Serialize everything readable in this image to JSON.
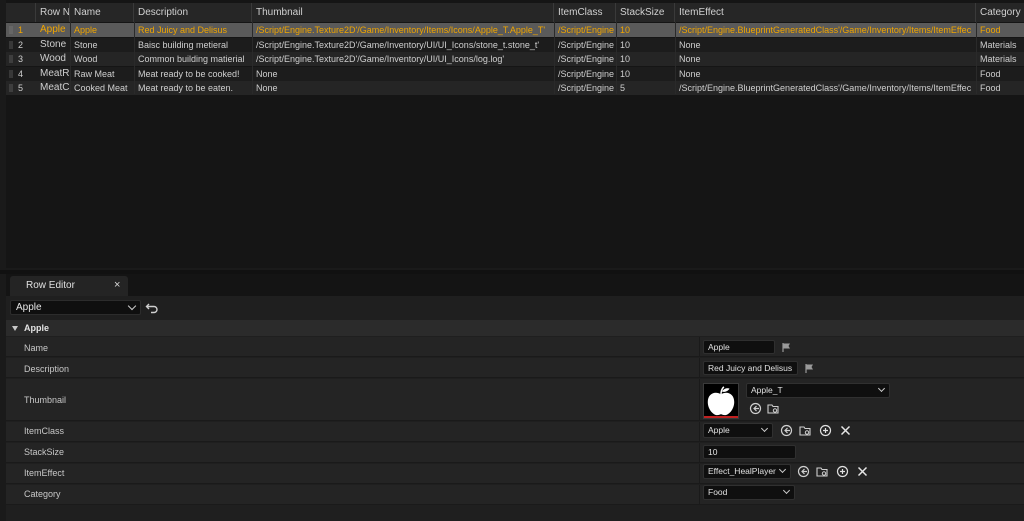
{
  "table": {
    "headers": [
      "",
      "Row Na",
      "Name",
      "Description",
      "Thumbnail",
      "ItemClass",
      "StackSize",
      "ItemEffect",
      "Category"
    ],
    "rows": [
      [
        "1",
        "Apple",
        "Apple",
        "Red Juicy and Delisus",
        "/Script/Engine.Texture2D'/Game/Inventory/Items/Icons/Apple_T.Apple_T'",
        "/Script/Engine",
        "10",
        "/Script/Engine.BlueprintGeneratedClass'/Game/Inventory/Items/ItemEffec",
        "Food"
      ],
      [
        "2",
        "Stone",
        "Stone",
        "Baisc building metieral",
        "/Script/Engine.Texture2D'/Game/Inventory/UI/UI_Icons/stone_t.stone_t'",
        "/Script/Engine",
        "10",
        "None",
        "Materials"
      ],
      [
        "3",
        "Wood",
        "Wood",
        "Common building matierial",
        "/Script/Engine.Texture2D'/Game/Inventory/UI/UI_Icons/log.log'",
        "/Script/Engine",
        "10",
        "None",
        "Materials"
      ],
      [
        "4",
        "MeatR",
        "Raw Meat",
        "Meat ready to be cooked!",
        "None",
        "/Script/Engine",
        "10",
        "None",
        "Food"
      ],
      [
        "5",
        "MeatC",
        "Cooked Meat",
        "Meat ready to be eaten.",
        "None",
        "/Script/Engine",
        "5",
        "/Script/Engine.BlueprintGeneratedClass'/Game/Inventory/Items/ItemEffec",
        "Food"
      ]
    ]
  },
  "row_editor": {
    "tab_label": "Row Editor",
    "close_glyph": "×",
    "selected_row": "Apple",
    "section_title": "Apple",
    "fields": {
      "name_label": "Name",
      "name_value": "Apple",
      "description_label": "Description",
      "description_value": "Red Juicy and Delisus",
      "thumbnail_label": "Thumbnail",
      "thumbnail_value": "Apple_T",
      "itemclass_label": "ItemClass",
      "itemclass_value": "Apple",
      "stacksize_label": "StackSize",
      "stacksize_value": "10",
      "itemeffect_label": "ItemEffect",
      "itemeffect_value": "Effect_HealPlayer",
      "category_label": "Category",
      "category_value": "Food"
    }
  },
  "colors": {
    "selected_text": "#f0a500",
    "background": "#1a1a1a",
    "thumbnail_accent": "#c02020"
  }
}
